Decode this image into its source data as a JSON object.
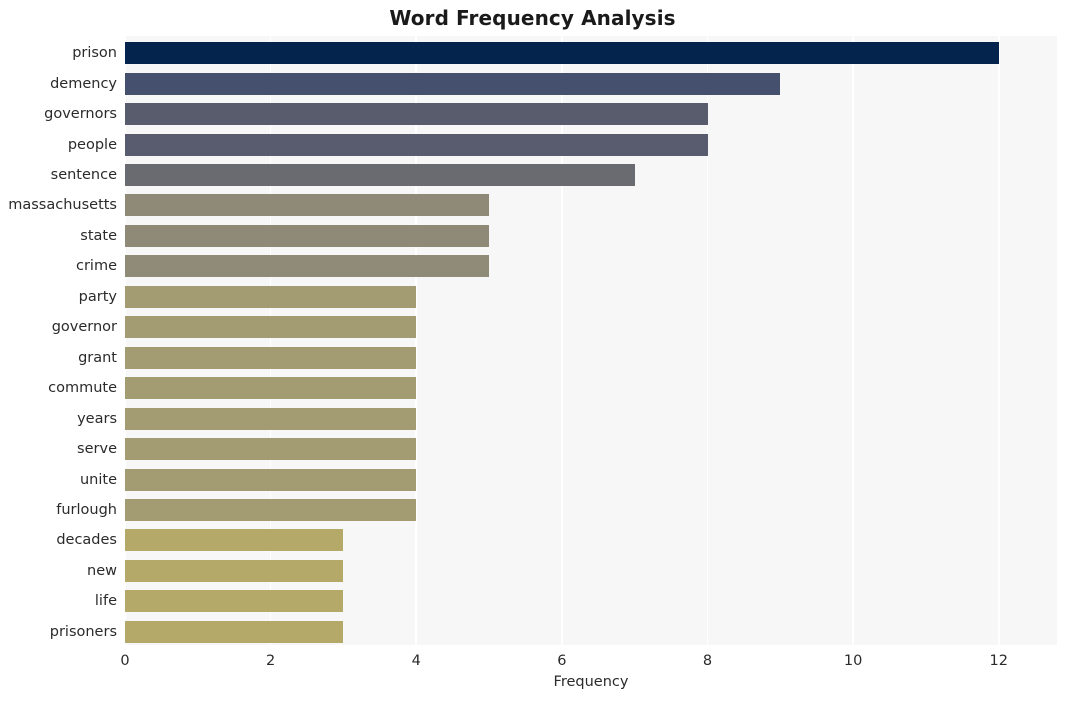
{
  "chart_data": {
    "type": "bar",
    "orientation": "horizontal",
    "title": "Word Frequency Analysis",
    "xlabel": "Frequency",
    "ylabel": "",
    "xlim": [
      0,
      12.8
    ],
    "xticks": [
      0,
      2,
      4,
      6,
      8,
      10,
      12
    ],
    "xtick_labels": [
      "0",
      "2",
      "4",
      "6",
      "8",
      "10",
      "12"
    ],
    "grid": "vertical",
    "legend": "none",
    "categories": [
      "prison",
      "demency",
      "governors",
      "people",
      "sentence",
      "massachusetts",
      "state",
      "crime",
      "party",
      "governor",
      "grant",
      "commute",
      "years",
      "serve",
      "unite",
      "furlough",
      "decades",
      "new",
      "life",
      "prisoners"
    ],
    "values": [
      12,
      9,
      8,
      8,
      7,
      5,
      5,
      5,
      4,
      4,
      4,
      4,
      4,
      4,
      4,
      4,
      3,
      3,
      3,
      3
    ],
    "bar_colors": [
      "#04234d",
      "#454f6e",
      "#585c6d",
      "#585c6e",
      "#6a6b70",
      "#8f8a78",
      "#8f8a78",
      "#908b79",
      "#a39b72",
      "#a39b72",
      "#a39b72",
      "#a39b72",
      "#a39b72",
      "#a39b72",
      "#a39b72",
      "#a39b72",
      "#b5a969",
      "#b5a969",
      "#b5a969",
      "#b5a969"
    ],
    "plot_background": "#f7f7f7",
    "figure_background": "#ffffff",
    "gridline_color": "#ffffff"
  }
}
